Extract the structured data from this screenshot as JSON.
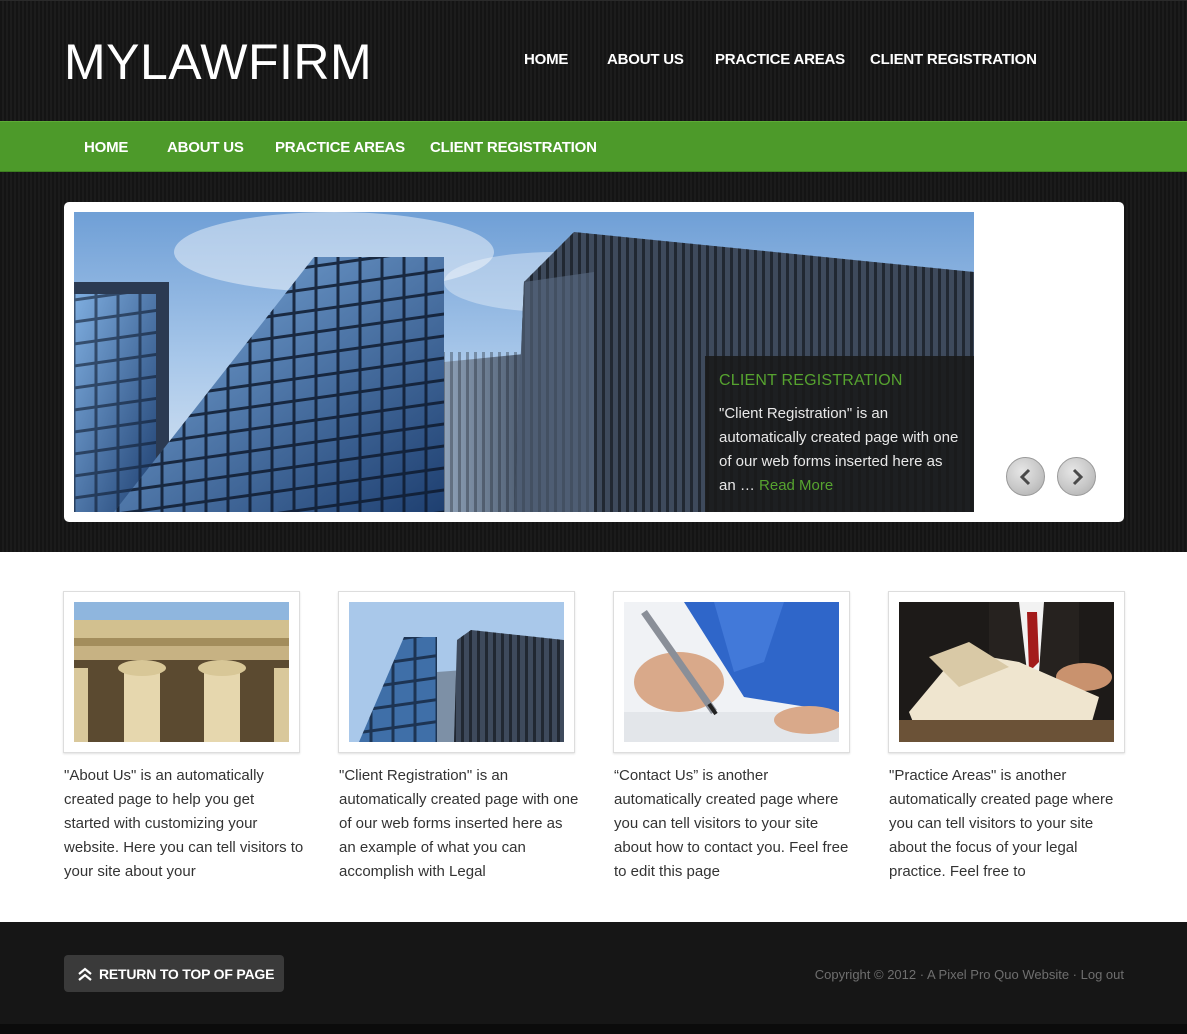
{
  "site": {
    "logo": "MYLAWFIRM"
  },
  "top_nav": {
    "items": [
      "HOME",
      "ABOUT US",
      "PRACTICE AREAS",
      "CLIENT REGISTRATION"
    ]
  },
  "green_nav": {
    "items": [
      "HOME",
      "ABOUT US",
      "PRACTICE AREAS",
      "CLIENT REGISTRATION"
    ]
  },
  "slider": {
    "caption_title": "CLIENT REGISTRATION",
    "caption_text": "\"Client Registration\" is an automatically created page with one of our web forms inserted here as an …",
    "read_more": "Read More",
    "prev_icon": "chevron-left-icon",
    "next_icon": "chevron-right-icon"
  },
  "features": [
    {
      "image": "courthouse-columns",
      "text": "\"About Us\" is an automatically created page to help you get started with customizing your website. Here you can tell visitors to your site about your"
    },
    {
      "image": "glass-skyscrapers",
      "text": "\"Client Registration\" is an automatically created page with one of our web forms inserted here as an example of what you can accomplish with Legal"
    },
    {
      "image": "hand-signing-document",
      "text": "“Contact Us” is another automatically created page where you can tell visitors to your site about how to contact you. Feel free to edit this page"
    },
    {
      "image": "lawyer-reading-book",
      "text": "\"Practice Areas\" is another automatically created page where you can tell visitors to your site about the focus of your legal practice. Feel free to"
    }
  ],
  "footer": {
    "return_top": "RETURN TO TOP OF PAGE",
    "copyright": "Copyright © 2012",
    "separator": " · ",
    "credit_link": "A Pixel Pro Quo Website",
    "logout": "Log out"
  },
  "colors": {
    "accent_green": "#4d9a2a",
    "header_dark": "#161616",
    "caption_green": "#56a32f"
  }
}
